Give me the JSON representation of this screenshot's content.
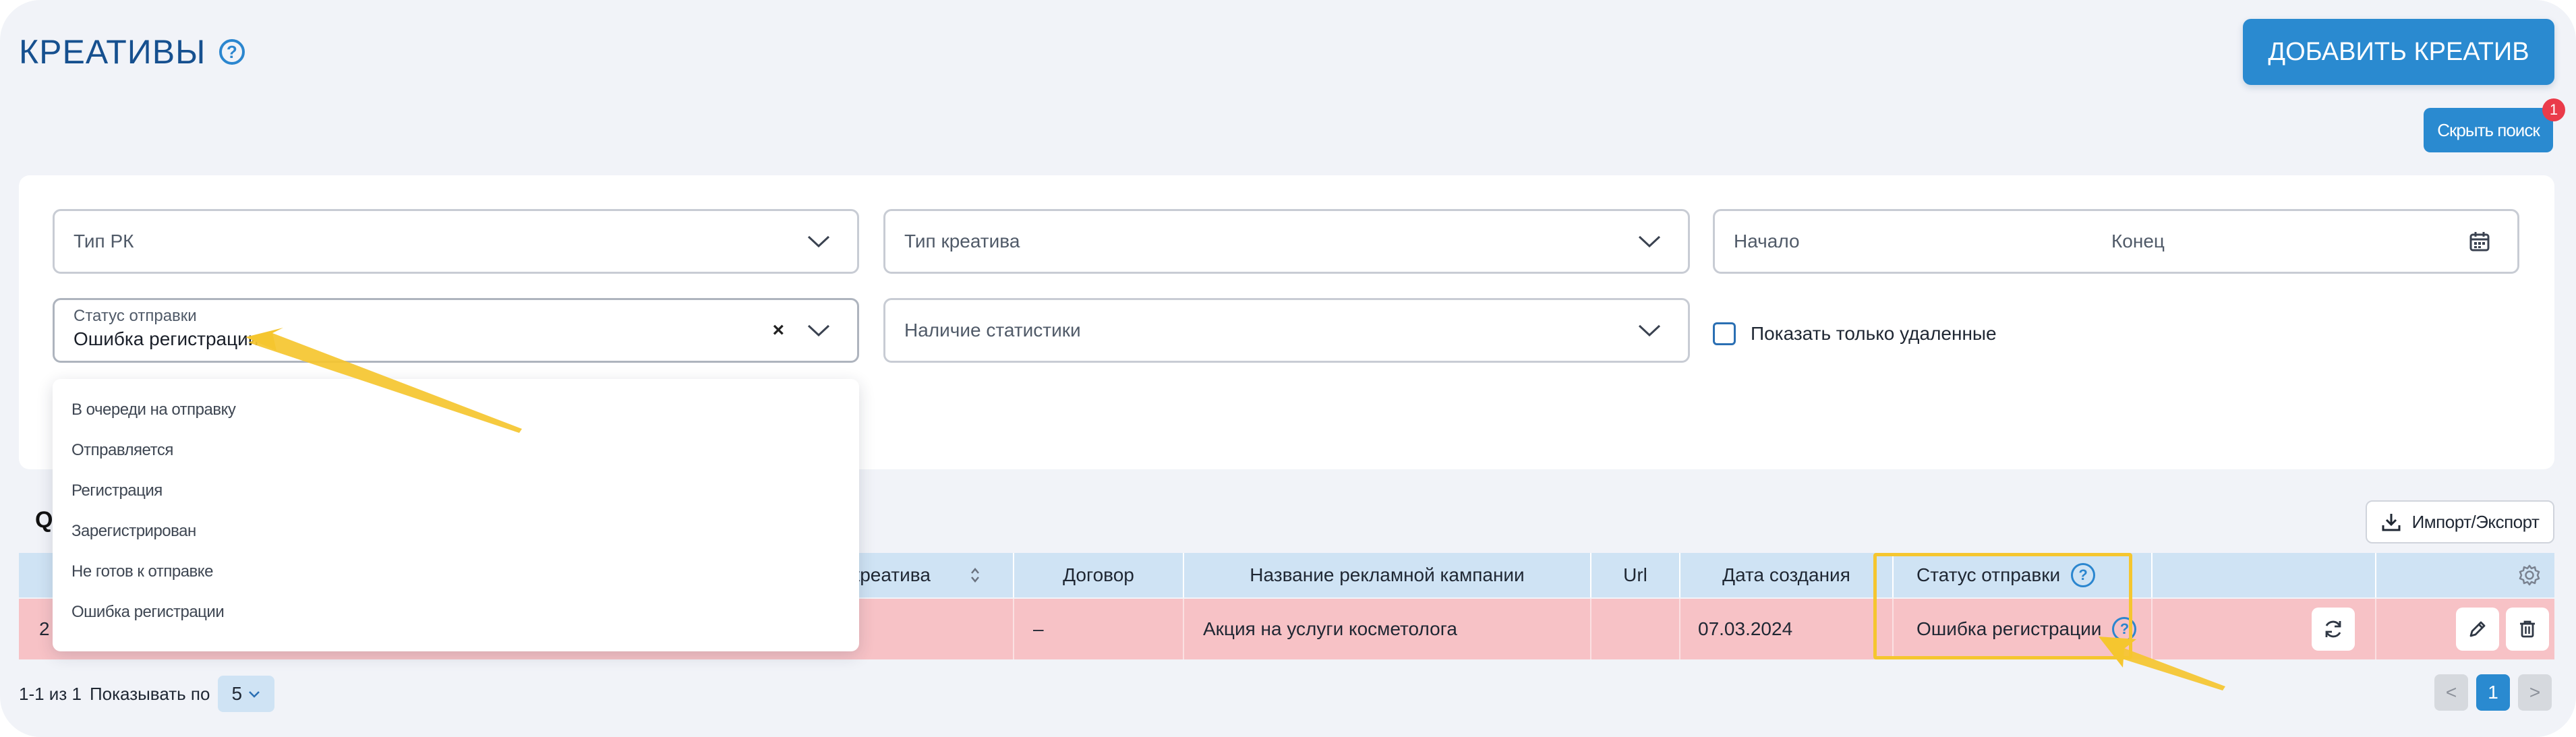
{
  "header": {
    "title": "КРЕАТИВЫ",
    "help_glyph": "?",
    "add_button": "ДОБАВИТЬ КРЕАТИВ",
    "hide_search_button": "Скрыть поиск",
    "hide_search_badge": "1"
  },
  "filters": {
    "rk_type_placeholder": "Тип РК",
    "creative_type_placeholder": "Тип креатива",
    "start_placeholder": "Начало",
    "end_placeholder": "Конец",
    "send_status_label": "Статус отправки",
    "send_status_value": "Ошибка регистрации",
    "clear_glyph": "×",
    "stats_placeholder": "Наличие статистики",
    "deleted_only_label": "Показать только удаленные",
    "deleted_only_checked": false
  },
  "dropdown": {
    "options": [
      "В очереди на отправку",
      "Отправляется",
      "Регистрация",
      "Зарегистрирован",
      "Не готов к отправке",
      "Ошибка регистрации"
    ]
  },
  "table": {
    "search_glyph": "Q",
    "import_export_label": "Импорт/Экспорт",
    "columns": {
      "creative_type": "п креатива",
      "contract": "Договор",
      "campaign_name": "Название рекламной кампании",
      "url": "Url",
      "created": "Дата создания",
      "send_status": "Статус отправки"
    },
    "rows": [
      {
        "first_cell": "2",
        "contract": "–",
        "campaign_name": "Акция на услуги косметолога",
        "url": "",
        "created": "07.03.2024",
        "send_status": "Ошибка регистрации",
        "row_color": "#f7c2c6"
      }
    ]
  },
  "pagination": {
    "range_text": "1-1 из 1",
    "per_page_label": "Показывать по",
    "per_page_value": "5",
    "current_page": "1",
    "prev_glyph": "<",
    "next_glyph": ">"
  },
  "colors": {
    "accent": "#2a8ad0",
    "title": "#16508f",
    "header_row": "#cfe3f4",
    "error_row": "#f7c2c6",
    "highlight": "#f5c62f",
    "badge": "#ea3b4a"
  }
}
